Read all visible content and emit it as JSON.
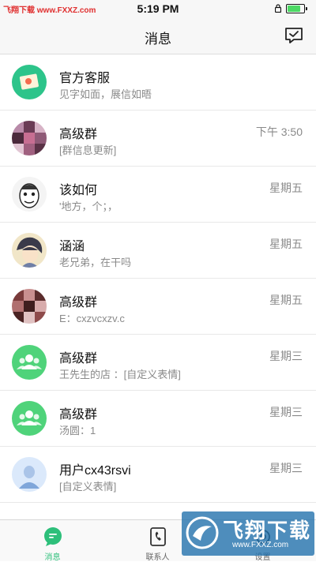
{
  "status_bar": {
    "watermark_left": "飞翔下载 www.FXXZ.com",
    "time": "5:19 PM",
    "battery_level": 0.9
  },
  "nav": {
    "title": "消息",
    "action_icon": "chat-check-icon"
  },
  "conversations": [
    {
      "name": "官方客服",
      "preview": "见字如面，展信如晤",
      "time": "",
      "avatar": "official-service-avatar",
      "color": "#2dc48a"
    },
    {
      "name": "高级群",
      "preview": "[群信息更新]",
      "time": "下午 3:50",
      "avatar": "group-photo-avatar"
    },
    {
      "name": "该如何",
      "preview": "'地方，个；，",
      "time": "星期五",
      "avatar": "cartoon-face-avatar"
    },
    {
      "name": "涵涵",
      "preview": "老兄弟，在干吗",
      "time": "星期五",
      "avatar": "anime-avatar"
    },
    {
      "name": "高级群",
      "preview": "E：cxzvcxzv.c",
      "time": "星期五",
      "avatar": "group-photo-avatar"
    },
    {
      "name": "高级群",
      "preview": "王先生的店 ：[自定义表情]",
      "time": "星期三",
      "avatar": "group-default-avatar",
      "color": "#4fd37a"
    },
    {
      "name": "高级群",
      "preview": "汤圆：1",
      "time": "星期三",
      "avatar": "group-default-avatar",
      "color": "#4fd37a"
    },
    {
      "name": "用户cx43rsvi",
      "preview": "[自定义表情]",
      "time": "星期三",
      "avatar": "user-default-avatar",
      "color": "#dbe9fb"
    }
  ],
  "tabs": [
    {
      "label": "消息",
      "icon": "message-icon",
      "active": true
    },
    {
      "label": "联系人",
      "icon": "contacts-icon",
      "active": false
    },
    {
      "label": "设置",
      "icon": "settings-icon",
      "active": false
    }
  ],
  "watermark_br": {
    "title": "飞翔下载",
    "url": "www.FXXZ.com"
  },
  "colors": {
    "accent": "#2dbf7a",
    "secondary_text": "#8a8a8a"
  }
}
